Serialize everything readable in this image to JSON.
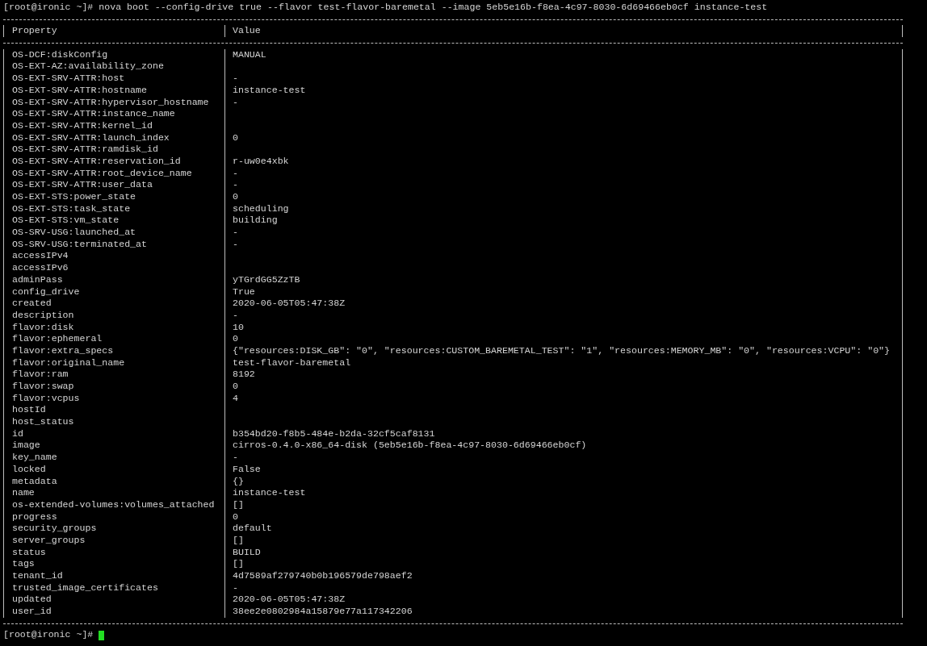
{
  "command": "[root@ironic ~]# nova boot --config-drive true --flavor test-flavor-baremetal --image 5eb5e16b-f8ea-4c97-8030-6d69466eb0cf instance-test",
  "table": {
    "columns": [
      "Property",
      "Value"
    ],
    "rows": [
      {
        "property": "OS-DCF:diskConfig",
        "value": "MANUAL"
      },
      {
        "property": "OS-EXT-AZ:availability_zone"
      },
      {
        "property": "OS-EXT-SRV-ATTR:host",
        "value": "-"
      },
      {
        "property": "OS-EXT-SRV-ATTR:hostname",
        "value": "instance-test"
      },
      {
        "property": "OS-EXT-SRV-ATTR:hypervisor_hostname",
        "value": "-"
      },
      {
        "property": "OS-EXT-SRV-ATTR:instance_name"
      },
      {
        "property": "OS-EXT-SRV-ATTR:kernel_id"
      },
      {
        "property": "OS-EXT-SRV-ATTR:launch_index",
        "value": "0"
      },
      {
        "property": "OS-EXT-SRV-ATTR:ramdisk_id"
      },
      {
        "property": "OS-EXT-SRV-ATTR:reservation_id",
        "value": "r-uw0e4xbk"
      },
      {
        "property": "OS-EXT-SRV-ATTR:root_device_name",
        "value": "-"
      },
      {
        "property": "OS-EXT-SRV-ATTR:user_data",
        "value": "-"
      },
      {
        "property": "OS-EXT-STS:power_state",
        "value": "0"
      },
      {
        "property": "OS-EXT-STS:task_state",
        "value": "scheduling"
      },
      {
        "property": "OS-EXT-STS:vm_state",
        "value": "building"
      },
      {
        "property": "OS-SRV-USG:launched_at",
        "value": "-"
      },
      {
        "property": "OS-SRV-USG:terminated_at",
        "value": "-"
      },
      {
        "property": "accessIPv4"
      },
      {
        "property": "accessIPv6"
      },
      {
        "property": "adminPass",
        "value": "yTGrdGG5ZzTB"
      },
      {
        "property": "config_drive",
        "value": "True"
      },
      {
        "property": "created",
        "value": "2020-06-05T05:47:38Z"
      },
      {
        "property": "description",
        "value": "-"
      },
      {
        "property": "flavor:disk",
        "value": "10"
      },
      {
        "property": "flavor:ephemeral",
        "value": "0"
      },
      {
        "property": "flavor:extra_specs",
        "value": "{\"resources:DISK_GB\": \"0\", \"resources:CUSTOM_BAREMETAL_TEST\": \"1\", \"resources:MEMORY_MB\": \"0\", \"resources:VCPU\": \"0\"}"
      },
      {
        "property": "flavor:original_name",
        "value": "test-flavor-baremetal"
      },
      {
        "property": "flavor:ram",
        "value": "8192"
      },
      {
        "property": "flavor:swap",
        "value": "0"
      },
      {
        "property": "flavor:vcpus",
        "value": "4"
      },
      {
        "property": "hostId"
      },
      {
        "property": "host_status"
      },
      {
        "property": "id",
        "value": "b354bd20-f8b5-484e-b2da-32cf5caf8131"
      },
      {
        "property": "image",
        "value": "cirros-0.4.0-x86_64-disk (5eb5e16b-f8ea-4c97-8030-6d69466eb0cf)"
      },
      {
        "property": "key_name",
        "value": "-"
      },
      {
        "property": "locked",
        "value": "False"
      },
      {
        "property": "metadata",
        "value": "{}"
      },
      {
        "property": "name",
        "value": "instance-test"
      },
      {
        "property": "os-extended-volumes:volumes_attached",
        "value": "[]"
      },
      {
        "property": "progress",
        "value": "0"
      },
      {
        "property": "security_groups",
        "value": "default"
      },
      {
        "property": "server_groups",
        "value": "[]"
      },
      {
        "property": "status",
        "value": "BUILD"
      },
      {
        "property": "tags",
        "value": "[]"
      },
      {
        "property": "tenant_id",
        "value": "4d7589af279740b0b196579de798aef2"
      },
      {
        "property": "trusted_image_certificates",
        "value": "-"
      },
      {
        "property": "updated",
        "value": "2020-06-05T05:47:38Z"
      },
      {
        "property": "user_id",
        "value": "38ee2e0802984a15879e77a117342206"
      }
    ]
  },
  "prompt": "[root@ironic ~]#"
}
